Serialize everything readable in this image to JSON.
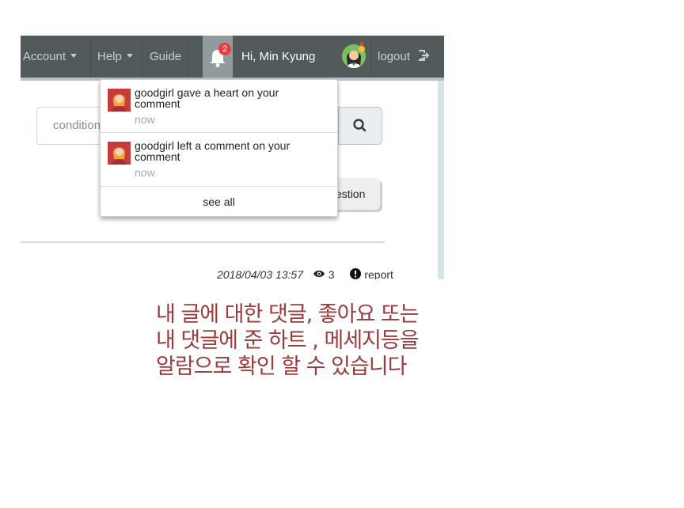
{
  "navbar": {
    "my_account": "y Account",
    "help": "Help",
    "guide": "Guide",
    "notification_count": "2",
    "greeting": "Hi, Min Kyung",
    "logout": "logout"
  },
  "search": {
    "value": "condition"
  },
  "question_button": {
    "label": "estion"
  },
  "post_meta": {
    "date": "2018/04/03 13:57",
    "views": "3",
    "report": "report"
  },
  "notifications": {
    "items": [
      {
        "text": "goodgirl gave a heart on your comment",
        "time": "now"
      },
      {
        "text": "goodgirl left a comment on your comment",
        "time": "now"
      }
    ],
    "see_all": "see all"
  },
  "caption": {
    "line1": "내 글에 대한 댓글, 좋아요 또는",
    "line2": "내 댓글에 준 하트 , 메세지등을",
    "line3": "알람으로 확인 할 수 있습니다"
  },
  "colors": {
    "navbar": "#525b5b",
    "badge": "#f03a3a",
    "caption": "#9b3b3b"
  }
}
